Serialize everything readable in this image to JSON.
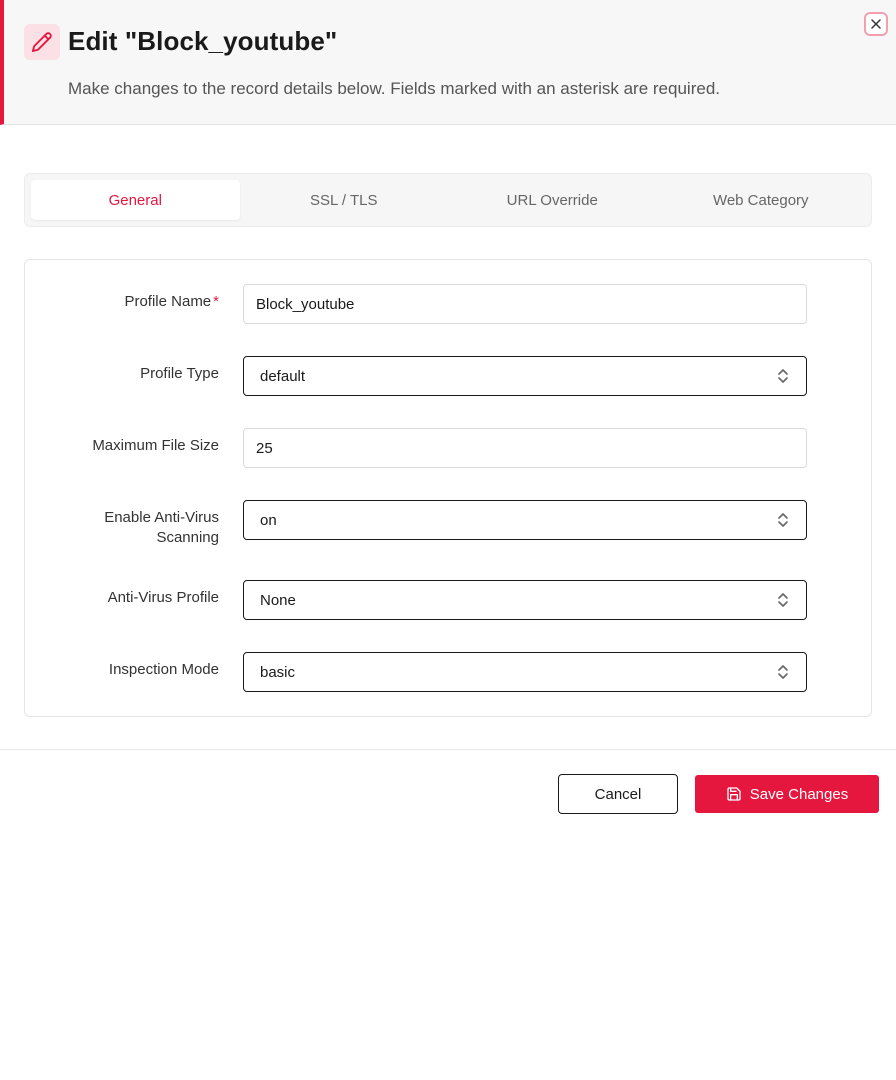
{
  "dialog": {
    "title": "Edit \"Block_youtube\"",
    "subtitle": "Make changes to the record details below. Fields marked with an asterisk are required.",
    "accent_color": "#e5173f"
  },
  "tabs": [
    {
      "label": "General",
      "active": true
    },
    {
      "label": "SSL / TLS",
      "active": false
    },
    {
      "label": "URL Override",
      "active": false
    },
    {
      "label": "Web Category",
      "active": false
    }
  ],
  "form": {
    "profile_name": {
      "label": "Profile Name",
      "required_mark": "*",
      "value": "Block_youtube"
    },
    "profile_type": {
      "label": "Profile Type",
      "value": "default"
    },
    "max_file_size": {
      "label": "Maximum File Size",
      "value": "25"
    },
    "enable_av": {
      "label": "Enable Anti-Virus Scanning",
      "value": "on"
    },
    "av_profile": {
      "label": "Anti-Virus Profile",
      "value": "None"
    },
    "inspection_mode": {
      "label": "Inspection Mode",
      "value": "basic"
    }
  },
  "footer": {
    "cancel_label": "Cancel",
    "save_label": "Save Changes"
  },
  "icons": {
    "edit": "pencil-icon",
    "close": "close-icon",
    "select": "chevron-updown-icon",
    "save": "floppy-disk-icon"
  }
}
